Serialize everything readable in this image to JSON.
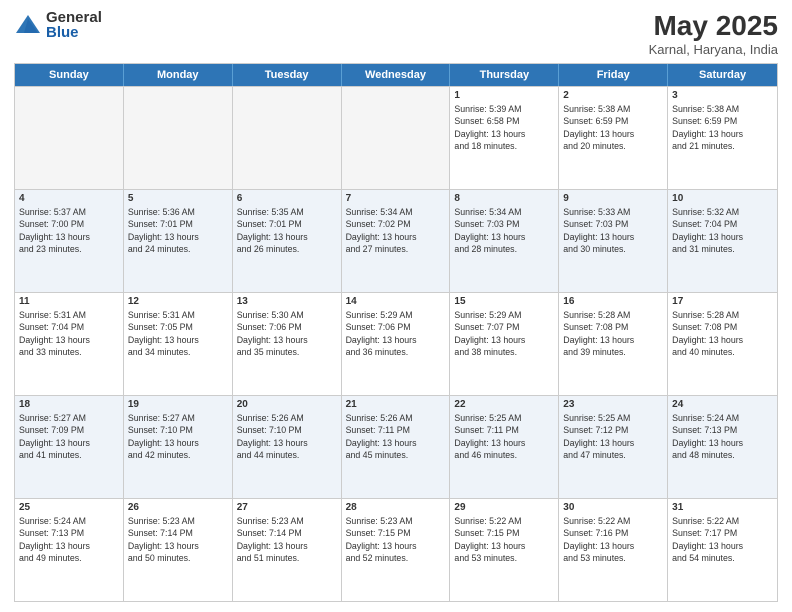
{
  "header": {
    "logo_general": "General",
    "logo_blue": "Blue",
    "title": "May 2025",
    "location": "Karnal, Haryana, India"
  },
  "weekdays": [
    "Sunday",
    "Monday",
    "Tuesday",
    "Wednesday",
    "Thursday",
    "Friday",
    "Saturday"
  ],
  "rows": [
    {
      "alt": false,
      "cells": [
        {
          "day": "",
          "info": ""
        },
        {
          "day": "",
          "info": ""
        },
        {
          "day": "",
          "info": ""
        },
        {
          "day": "",
          "info": ""
        },
        {
          "day": "1",
          "info": "Sunrise: 5:39 AM\nSunset: 6:58 PM\nDaylight: 13 hours\nand 18 minutes."
        },
        {
          "day": "2",
          "info": "Sunrise: 5:38 AM\nSunset: 6:59 PM\nDaylight: 13 hours\nand 20 minutes."
        },
        {
          "day": "3",
          "info": "Sunrise: 5:38 AM\nSunset: 6:59 PM\nDaylight: 13 hours\nand 21 minutes."
        }
      ]
    },
    {
      "alt": true,
      "cells": [
        {
          "day": "4",
          "info": "Sunrise: 5:37 AM\nSunset: 7:00 PM\nDaylight: 13 hours\nand 23 minutes."
        },
        {
          "day": "5",
          "info": "Sunrise: 5:36 AM\nSunset: 7:01 PM\nDaylight: 13 hours\nand 24 minutes."
        },
        {
          "day": "6",
          "info": "Sunrise: 5:35 AM\nSunset: 7:01 PM\nDaylight: 13 hours\nand 26 minutes."
        },
        {
          "day": "7",
          "info": "Sunrise: 5:34 AM\nSunset: 7:02 PM\nDaylight: 13 hours\nand 27 minutes."
        },
        {
          "day": "8",
          "info": "Sunrise: 5:34 AM\nSunset: 7:03 PM\nDaylight: 13 hours\nand 28 minutes."
        },
        {
          "day": "9",
          "info": "Sunrise: 5:33 AM\nSunset: 7:03 PM\nDaylight: 13 hours\nand 30 minutes."
        },
        {
          "day": "10",
          "info": "Sunrise: 5:32 AM\nSunset: 7:04 PM\nDaylight: 13 hours\nand 31 minutes."
        }
      ]
    },
    {
      "alt": false,
      "cells": [
        {
          "day": "11",
          "info": "Sunrise: 5:31 AM\nSunset: 7:04 PM\nDaylight: 13 hours\nand 33 minutes."
        },
        {
          "day": "12",
          "info": "Sunrise: 5:31 AM\nSunset: 7:05 PM\nDaylight: 13 hours\nand 34 minutes."
        },
        {
          "day": "13",
          "info": "Sunrise: 5:30 AM\nSunset: 7:06 PM\nDaylight: 13 hours\nand 35 minutes."
        },
        {
          "day": "14",
          "info": "Sunrise: 5:29 AM\nSunset: 7:06 PM\nDaylight: 13 hours\nand 36 minutes."
        },
        {
          "day": "15",
          "info": "Sunrise: 5:29 AM\nSunset: 7:07 PM\nDaylight: 13 hours\nand 38 minutes."
        },
        {
          "day": "16",
          "info": "Sunrise: 5:28 AM\nSunset: 7:08 PM\nDaylight: 13 hours\nand 39 minutes."
        },
        {
          "day": "17",
          "info": "Sunrise: 5:28 AM\nSunset: 7:08 PM\nDaylight: 13 hours\nand 40 minutes."
        }
      ]
    },
    {
      "alt": true,
      "cells": [
        {
          "day": "18",
          "info": "Sunrise: 5:27 AM\nSunset: 7:09 PM\nDaylight: 13 hours\nand 41 minutes."
        },
        {
          "day": "19",
          "info": "Sunrise: 5:27 AM\nSunset: 7:10 PM\nDaylight: 13 hours\nand 42 minutes."
        },
        {
          "day": "20",
          "info": "Sunrise: 5:26 AM\nSunset: 7:10 PM\nDaylight: 13 hours\nand 44 minutes."
        },
        {
          "day": "21",
          "info": "Sunrise: 5:26 AM\nSunset: 7:11 PM\nDaylight: 13 hours\nand 45 minutes."
        },
        {
          "day": "22",
          "info": "Sunrise: 5:25 AM\nSunset: 7:11 PM\nDaylight: 13 hours\nand 46 minutes."
        },
        {
          "day": "23",
          "info": "Sunrise: 5:25 AM\nSunset: 7:12 PM\nDaylight: 13 hours\nand 47 minutes."
        },
        {
          "day": "24",
          "info": "Sunrise: 5:24 AM\nSunset: 7:13 PM\nDaylight: 13 hours\nand 48 minutes."
        }
      ]
    },
    {
      "alt": false,
      "cells": [
        {
          "day": "25",
          "info": "Sunrise: 5:24 AM\nSunset: 7:13 PM\nDaylight: 13 hours\nand 49 minutes."
        },
        {
          "day": "26",
          "info": "Sunrise: 5:23 AM\nSunset: 7:14 PM\nDaylight: 13 hours\nand 50 minutes."
        },
        {
          "day": "27",
          "info": "Sunrise: 5:23 AM\nSunset: 7:14 PM\nDaylight: 13 hours\nand 51 minutes."
        },
        {
          "day": "28",
          "info": "Sunrise: 5:23 AM\nSunset: 7:15 PM\nDaylight: 13 hours\nand 52 minutes."
        },
        {
          "day": "29",
          "info": "Sunrise: 5:22 AM\nSunset: 7:15 PM\nDaylight: 13 hours\nand 53 minutes."
        },
        {
          "day": "30",
          "info": "Sunrise: 5:22 AM\nSunset: 7:16 PM\nDaylight: 13 hours\nand 53 minutes."
        },
        {
          "day": "31",
          "info": "Sunrise: 5:22 AM\nSunset: 7:17 PM\nDaylight: 13 hours\nand 54 minutes."
        }
      ]
    }
  ]
}
